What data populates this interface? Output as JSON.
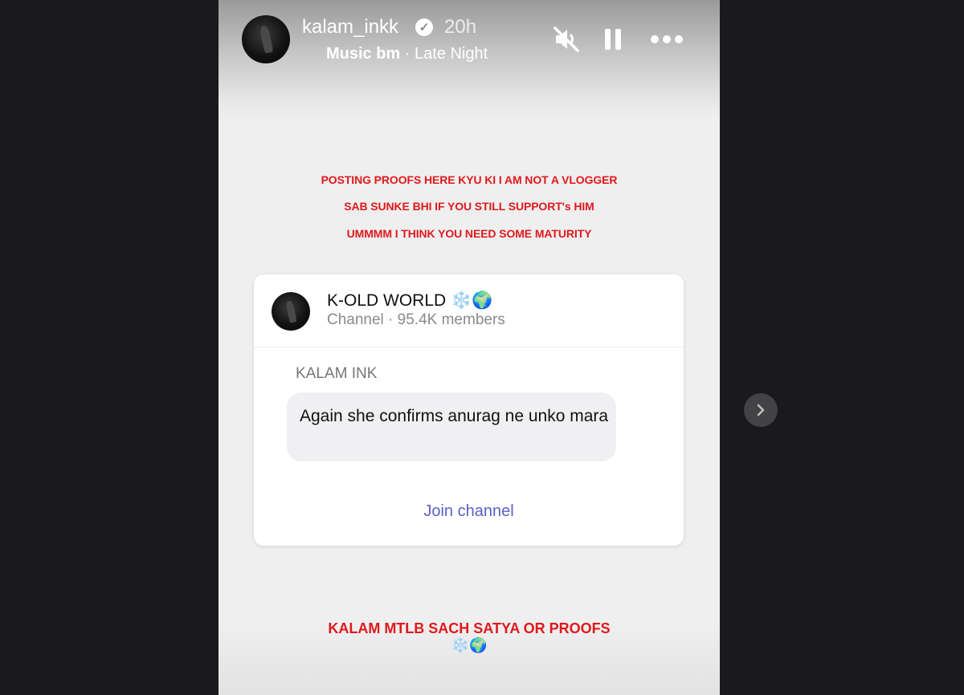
{
  "header": {
    "username": "kalam_inkk",
    "verified_icon": "verified-badge-icon",
    "time_ago": "20h",
    "music_title": "Music bm",
    "music_separator": " · ",
    "music_artist": "Late Night",
    "controls": [
      "mute-icon",
      "pause-icon",
      "more-icon"
    ]
  },
  "captions": [
    "POSTING PROOFS HERE KYU KI I AM NOT A VLOGGER",
    "SAB SUNKE BHI IF YOU STILL SUPPORT's HIM",
    "UMMMM I THINK YOU NEED SOME MATURITY"
  ],
  "card": {
    "channel_name": "K-OLD WORLD ❄️🌍",
    "channel_sub": "Channel · 95.4K members",
    "sender": "KALAM INK",
    "message": "Again she confirms anurag ne unko mara",
    "join_label": "Join channel"
  },
  "bottom": {
    "caption": "KALAM MTLB SACH SATYA OR PROOFS",
    "emoji": "❄️🌍"
  },
  "navigation": {
    "next_icon": "chevron-right-icon"
  },
  "colors": {
    "caption_red": "#e0191b",
    "join_link": "#5b5fc7",
    "backdrop": "#1a191b"
  }
}
